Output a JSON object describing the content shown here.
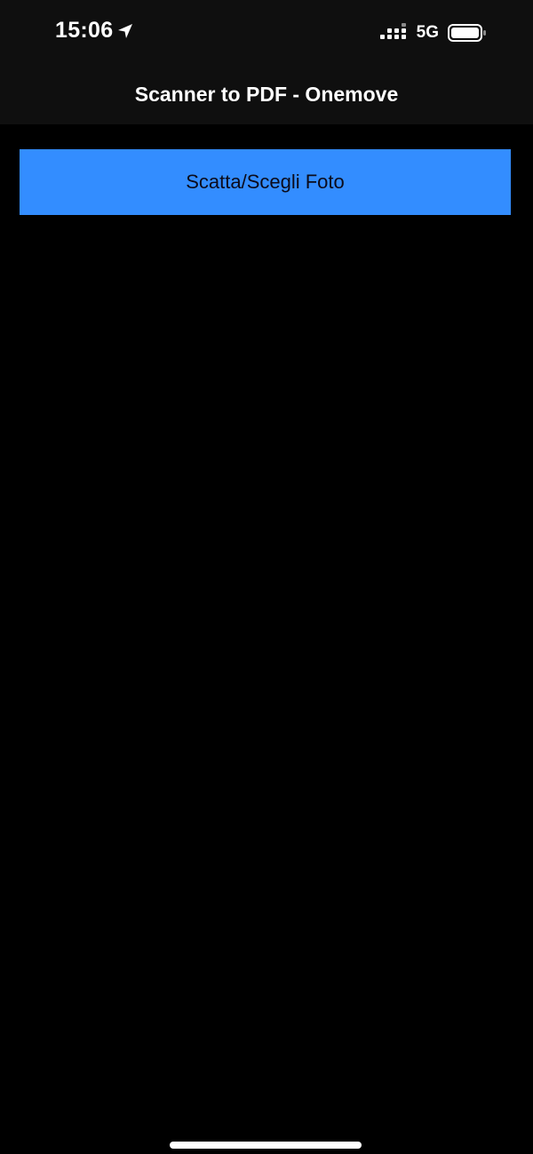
{
  "status_bar": {
    "time": "15:06",
    "network": "5G",
    "icons": [
      "location-arrow-icon",
      "signal-icon",
      "battery-icon"
    ]
  },
  "nav": {
    "title": "Scanner to PDF - Onemove"
  },
  "main": {
    "button_label": "Scatta/Scegli Foto"
  },
  "colors": {
    "background": "#000000",
    "top_bar": "#0f0f0f",
    "button": "#338dff",
    "button_text": "#0b0b1a"
  }
}
